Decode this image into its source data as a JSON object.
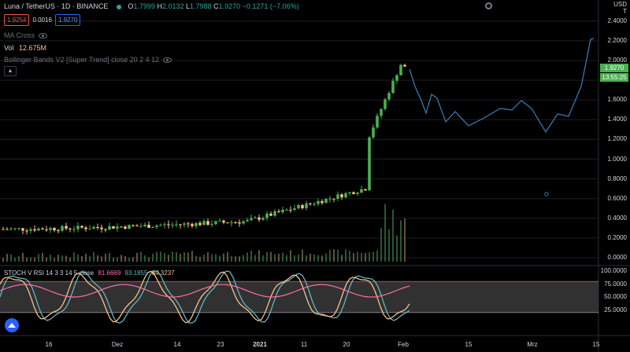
{
  "header": {
    "symbol": "Luna / TetherUS · 1D · BINANCE",
    "o_label": "O",
    "o_value": "1.7999",
    "h_label": "H",
    "h_value": "2.0132",
    "l_label": "L",
    "l_value": "1.7988",
    "c_label": "C",
    "c_value": "1.9270",
    "change": "−0.1271 (−7.06%)",
    "bid": "1.9254",
    "spread": "0.0016",
    "ask": "1.9270"
  },
  "indicators": {
    "ma_cross": "MA Cross",
    "vol_label": "Vol",
    "vol_value": "12.675M",
    "bollinger": "Bollinger Bands V2 [Super Trend] close 20 2 4 12",
    "collapse_icon": "chevron-up-icon"
  },
  "stoch": {
    "label": "STOCH V RSI 14 3 3 14 5 close",
    "v1": "81.6669",
    "v2": "93.1855",
    "v3": "84.3237"
  },
  "y_axis": {
    "currency_top": "USD",
    "currency_bottom": "T",
    "ticks": [
      "2.4000",
      "2.2000",
      "2.0000",
      "1.8000",
      "1.6000",
      "1.4000",
      "1.2000",
      "1.0000",
      "0.8000",
      "0.6000",
      "0.4000",
      "0.2000",
      "0.0000"
    ],
    "price_label": "1.9270",
    "time_label": "13:55:25",
    "stoch_ticks": [
      "100.0000",
      "75.0000",
      "50.0000",
      "25.0000"
    ]
  },
  "x_axis": {
    "labels": [
      "16",
      "Dez",
      "14",
      "23",
      "2021",
      "11",
      "20",
      "Feb",
      "15",
      "Mrz",
      "15"
    ]
  },
  "colors": {
    "up": "#4caf50",
    "down": "#f5c28b",
    "projection": "#3d7fb5",
    "stoch_k": "#ff6ea7",
    "stoch_d": "#f5c28b",
    "stoch_rsi": "#5fb6c4",
    "price_label_bg": "#4caf50"
  }
}
